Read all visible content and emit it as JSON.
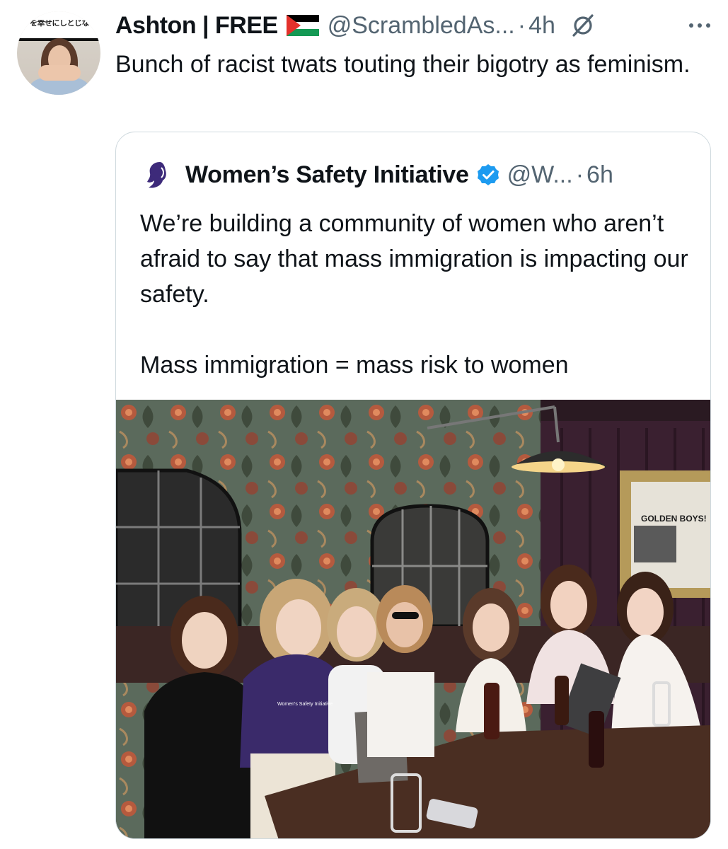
{
  "tweet": {
    "author_name": "Ashton | FREE",
    "flag_icon": "palestine-flag-icon",
    "handle": "@ScrambledAs...",
    "separator": "·",
    "time": "4h",
    "avatar_banner_text": "を幸せにしとじないカツ丼",
    "text": "Bunch of racist twats touting their bigotry as feminism."
  },
  "quote": {
    "author_name": "Women’s Safety Initiative",
    "verified_icon": "verified-badge-icon",
    "handle": "@W...",
    "separator": "·",
    "time": "6h",
    "text_line_1": "We’re building a community of women who aren’t afraid to say that mass immigration is impacting our safety.",
    "text_line_2": "Mass immigration = mass risk to women",
    "photo": {
      "poster_text_1": "GOLDEN BOYS!",
      "shirt_text": "Women's Safety Initiative"
    }
  },
  "colors": {
    "text": "#0f1419",
    "secondary": "#536471",
    "border": "#cfd9de",
    "verified": "#1d9bf0",
    "brand_purple": "#3d2a7a"
  }
}
